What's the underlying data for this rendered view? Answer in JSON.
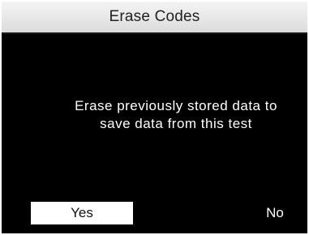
{
  "header": {
    "title": "Erase Codes"
  },
  "dialog": {
    "message_line1": "Erase previously stored data to",
    "message_line2": "save data from this test"
  },
  "buttons": {
    "yes_label": "Yes",
    "no_label": "No",
    "selected": "Yes"
  },
  "colors": {
    "screen_background": "#000000",
    "title_bar": "#e6e6e6",
    "text": "#ffffff",
    "selected_button": "#ffffff"
  }
}
